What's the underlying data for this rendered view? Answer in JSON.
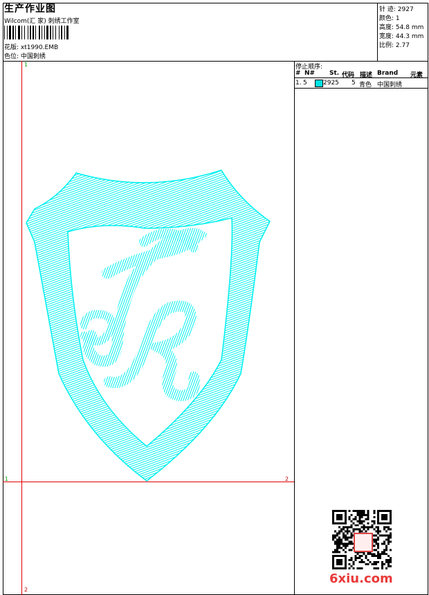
{
  "header": {
    "title": "生产作业图",
    "company": "Wilcom(汇 家) 刺绣工作室",
    "pattern_label": "花版:",
    "pattern_value": "xt1990.EMB",
    "colorpos_label": "色位:",
    "colorpos_value": "中国刺绣"
  },
  "stats": [
    {
      "label": "针 迹:",
      "value": "2927"
    },
    {
      "label": "颜色:",
      "value": "1"
    },
    {
      "label": "高度:",
      "value": "54.8 mm"
    },
    {
      "label": "宽度:",
      "value": "44.3 mm"
    },
    {
      "label": "比例:",
      "value": "2.77"
    }
  ],
  "stop_sequence": {
    "title": "停止顺序:",
    "headers": {
      "num": "#",
      "no": "N#",
      "st": "St.",
      "code": "代码",
      "desc": "描述",
      "brand": "Brand",
      "element": "元素"
    },
    "rows": [
      {
        "num": "1.",
        "no": "5",
        "st": "2925",
        "code": "5",
        "desc": "青色",
        "brand": "中国刺绣",
        "color": "#00e5e5"
      }
    ]
  },
  "design": {
    "monogram": "TR",
    "thread_color": "#00f0f0"
  },
  "axes": {
    "x_start": "1",
    "x_end": "2",
    "y_start": "1",
    "y_end": "2"
  },
  "watermark": "6xiu.com",
  "colors": {
    "guide_red": "#e00000",
    "guide_green": "#00a000",
    "thread": "#00f0f0",
    "watermark": "#e83a3a"
  }
}
